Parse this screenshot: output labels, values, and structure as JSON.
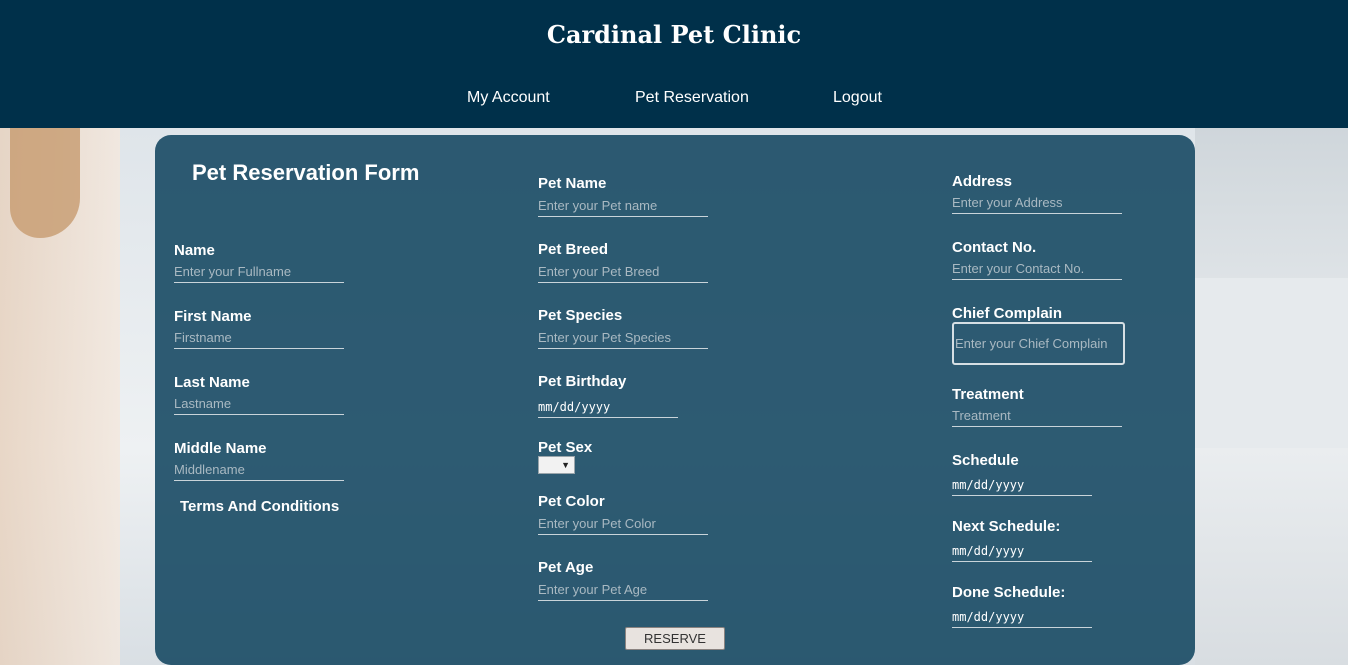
{
  "site_title": "Cardinal Pet Clinic",
  "nav": [
    "My Account",
    "Pet Reservation",
    "Logout"
  ],
  "form_title": "Pet Reservation Form",
  "owner": {
    "name": {
      "label": "Name",
      "placeholder": "Enter your Fullname"
    },
    "first_name": {
      "label": "First Name",
      "placeholder": "Firstname"
    },
    "last_name": {
      "label": "Last Name",
      "placeholder": "Lastname"
    },
    "middle_name": {
      "label": "Middle Name",
      "placeholder": "Middlename"
    },
    "terms": "Terms And Conditions"
  },
  "pet": {
    "name": {
      "label": "Pet Name",
      "placeholder": "Enter your Pet name"
    },
    "breed": {
      "label": "Pet Breed",
      "placeholder": "Enter your Pet Breed"
    },
    "species": {
      "label": "Pet Species",
      "placeholder": "Enter your Pet Species"
    },
    "birthday": {
      "label": "Pet Birthday",
      "value": "mm/dd/yyyy"
    },
    "sex": {
      "label": "Pet Sex",
      "value": ""
    },
    "color": {
      "label": "Pet Color",
      "placeholder": "Enter your Pet Color"
    },
    "age": {
      "label": "Pet Age",
      "placeholder": "Enter your Pet Age"
    }
  },
  "visit": {
    "address": {
      "label": "Address",
      "placeholder": "Enter your Address"
    },
    "contact": {
      "label": "Contact No.",
      "placeholder": "Enter your Contact No."
    },
    "complain": {
      "label": "Chief Complain",
      "placeholder": "Enter your Chief Complain"
    },
    "treatment": {
      "label": "Treatment",
      "placeholder": "Treatment"
    },
    "schedule": {
      "label": "Schedule",
      "value": "mm/dd/yyyy"
    },
    "next_schedule": {
      "label": "Next Schedule:",
      "value": "mm/dd/yyyy"
    },
    "done_schedule": {
      "label": "Done Schedule:",
      "value": "mm/dd/yyyy"
    }
  },
  "reserve_button": "RESERVE",
  "select_arrow_icon": "triangle-down-icon",
  "colors": {
    "header": "#00304a",
    "panel": "#124660",
    "text": "#ffffff"
  }
}
